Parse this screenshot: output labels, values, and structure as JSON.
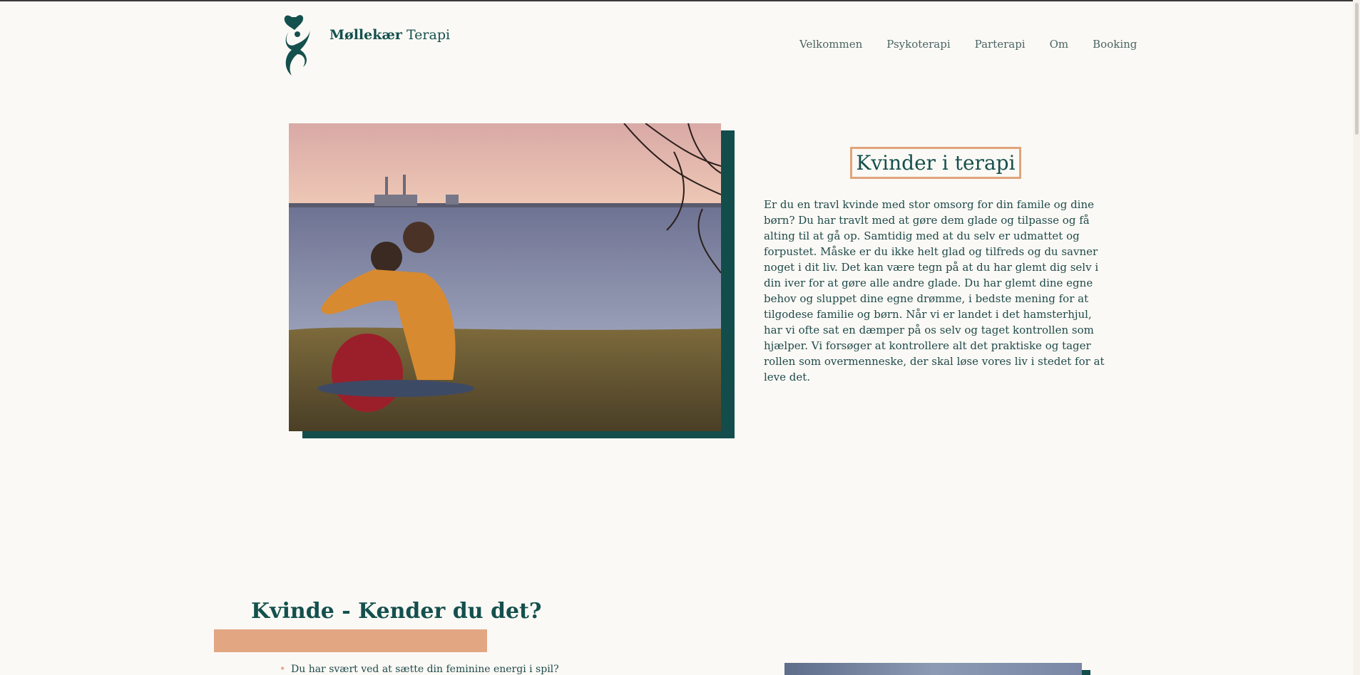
{
  "header": {
    "brand_bold": "Møllekær",
    "brand_rest": " Terapi",
    "logo_icon": "heart-figure-logo"
  },
  "nav": {
    "items": [
      "Velkommen",
      "Psykoterapi",
      "Parterapi",
      "Om",
      "Booking"
    ]
  },
  "hero": {
    "title": "Kvinder i terapi",
    "body": "Er du en travl kvinde med stor omsorg for din famile og dine børn? Du har travlt med at gøre dem glade og tilpasse og få alting til at gå op. Samtidig med at du selv er udmattet og forpustet. Måske er du ikke helt glad og tilfreds og du savner noget i dit liv. Det kan være tegn på at du har glemt dig selv i din iver for at gøre alle andre glade. Du har glemt dine egne behov og sluppet dine egne drømme, i bedste mening for at tilgodese familie og børn. Når vi er landet i det hamsterhjul, har vi ofte sat en dæmper på os selv og taget kontrollen som hjælper. Vi forsøger at kontrollere alt det praktiske og tager rollen som overmenneske, der skal løse vores liv i stedet for at leve det."
  },
  "section2": {
    "title": "Kvinde - Kender du det?",
    "list": [
      "Du har svært ved at sætte din feminine energi i spil?"
    ]
  },
  "colors": {
    "accent": "#e3a683",
    "brand": "#14504d",
    "background": "#fbf9f5"
  }
}
